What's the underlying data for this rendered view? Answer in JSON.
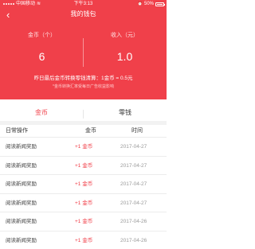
{
  "statusbar": {
    "carrier": "中国移动",
    "wifi": "≋",
    "time": "下午3:13",
    "alarm": "⏰",
    "battery": "50%"
  },
  "nav": {
    "back": "‹",
    "title": "我的钱包"
  },
  "stats": {
    "coins_label": "金币（个）",
    "coins_value": "6",
    "income_label": "收入（元）",
    "income_value": "1.0"
  },
  "rate": {
    "text": "昨日最后金币转换零钱清算：1金币 = 0.5元",
    "note": "*金币转换汇率受每日广告收益影响"
  },
  "tabs": [
    {
      "label": "金币"
    },
    {
      "label": "零钱"
    }
  ],
  "table": {
    "headers": {
      "op": "日常操作",
      "coin": "金币",
      "time": "时间"
    },
    "rows": [
      {
        "op": "阅读新闻奖励",
        "coin": "+1 金币",
        "time": "2017-04-27"
      },
      {
        "op": "阅读新闻奖励",
        "coin": "+1 金币",
        "time": "2017-04-27"
      },
      {
        "op": "阅读新闻奖励",
        "coin": "+1 金币",
        "time": "2017-04-27"
      },
      {
        "op": "阅读新闻奖励",
        "coin": "+1 金币",
        "time": "2017-04-27"
      },
      {
        "op": "阅读新闻奖励",
        "coin": "+1 金币",
        "time": "2017-04-26"
      },
      {
        "op": "阅读新闻奖励",
        "coin": "+1 金币",
        "time": "2017-04-26"
      }
    ]
  },
  "colors": {
    "accent": "#f0404a"
  }
}
